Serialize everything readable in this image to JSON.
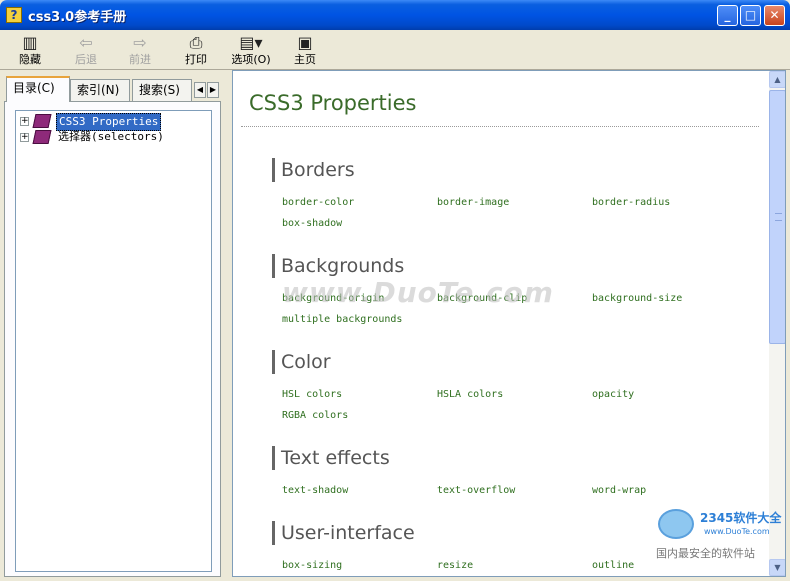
{
  "window": {
    "title": "css3.0参考手册",
    "icon": "help-file-icon",
    "minimize": "_",
    "maximize": "□",
    "close": "✕"
  },
  "toolbar": {
    "hide": {
      "label": "隐藏",
      "icon": "hide-pane-icon"
    },
    "back": {
      "label": "后退",
      "icon": "back-arrow-icon"
    },
    "forward": {
      "label": "前进",
      "icon": "forward-arrow-icon"
    },
    "print": {
      "label": "打印",
      "icon": "printer-icon"
    },
    "options": {
      "label": "选项(O)",
      "icon": "options-icon"
    },
    "home": {
      "label": "主页",
      "icon": "home-page-icon"
    }
  },
  "nav": {
    "tabs": [
      {
        "label": "目录(C)"
      },
      {
        "label": "索引(N)"
      },
      {
        "label": "搜索(S)"
      }
    ],
    "tree": [
      {
        "label": "CSS3 Properties",
        "selected": true
      },
      {
        "label": "选择器(selectors)",
        "selected": false
      }
    ]
  },
  "content": {
    "title": "CSS3 Properties",
    "sections": [
      {
        "heading": "Borders",
        "items": [
          "border-color",
          "border-image",
          "border-radius",
          "box-shadow"
        ]
      },
      {
        "heading": "Backgrounds",
        "items": [
          "background-origin",
          "background-clip",
          "background-size",
          "multiple backgrounds"
        ]
      },
      {
        "heading": "Color",
        "items": [
          "HSL colors",
          "HSLA colors",
          "opacity",
          "RGBA colors"
        ]
      },
      {
        "heading": "Text effects",
        "items": [
          "text-shadow",
          "text-overflow",
          "word-wrap"
        ]
      },
      {
        "heading": "User-interface",
        "items": [
          "box-sizing",
          "resize",
          "outline"
        ]
      }
    ]
  },
  "watermark": {
    "text": "www.DuoTe.com"
  },
  "badge": {
    "top": "2345软件大全",
    "mid": "www.DuoTe.com",
    "bottom": "国内最安全的软件站"
  },
  "colors": {
    "title_bar": "#0054e3",
    "page_title": "#3a6b2a",
    "link": "#2f6f1f",
    "selection": "#316ac5"
  }
}
